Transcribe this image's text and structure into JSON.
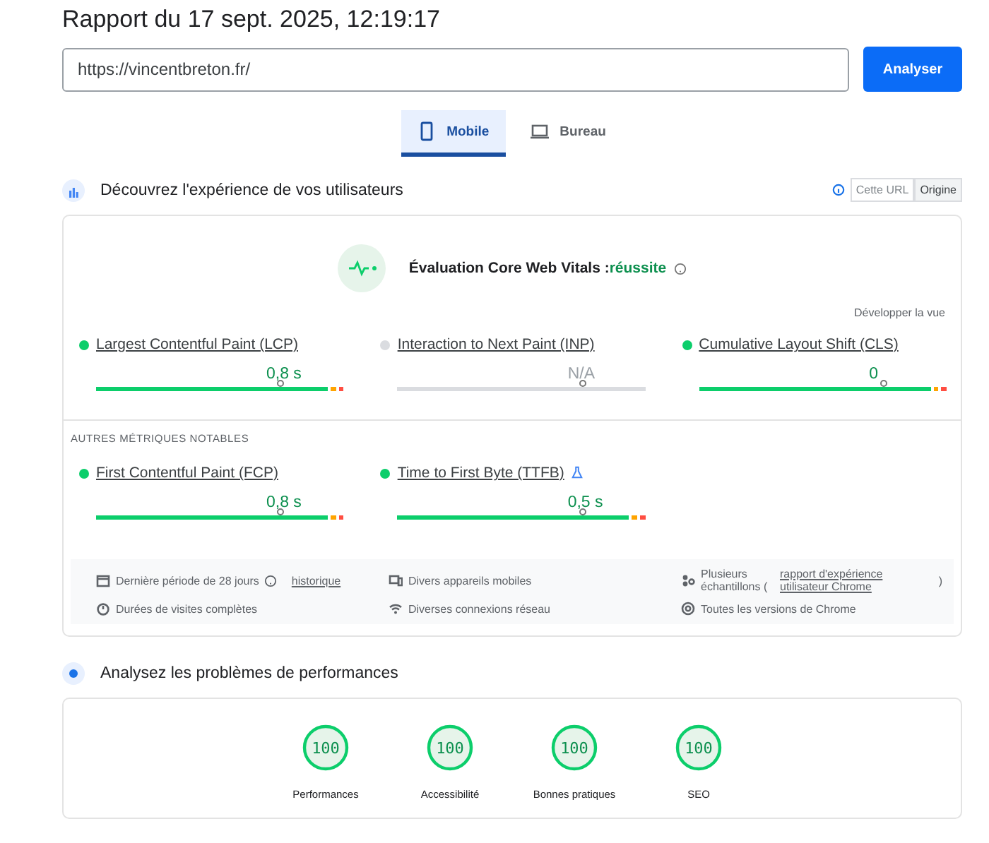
{
  "title": "Rapport du 17 sept. 2025, 12:19:17",
  "url_field": {
    "value": "https://vincentbreton.fr/"
  },
  "analyze_button": "Analyser",
  "tabs": [
    {
      "label": "Mobile",
      "selected": true
    },
    {
      "label": "Bureau",
      "selected": false
    }
  ],
  "experience": {
    "heading": "Découvrez l'expérience de vos utilisateurs",
    "toggle": [
      {
        "label": "Cette URL",
        "selected": false,
        "disabled": true
      },
      {
        "label": "Origine",
        "selected": true,
        "disabled": false
      }
    ],
    "assessment_label": "Évaluation Core Web Vitals :",
    "assessment_result": "réussite",
    "expand_link": "Développer la vue",
    "core_metrics": [
      {
        "name": "Largest Contentful Paint (LCP)",
        "value": "0,8 s",
        "color": "#0cce6b",
        "kind": "rated",
        "level": 0.75,
        "lab": false
      },
      {
        "name": "Interaction to Next Paint (INP)",
        "value": "N/A",
        "color": "#dadce0",
        "kind": "empty",
        "level": 0.75,
        "lab": false
      },
      {
        "name": "Cumulative Layout Shift (CLS)",
        "value": "0",
        "color": "#0cce6b",
        "kind": "rated",
        "level": 0.75,
        "lab": false
      }
    ],
    "other_heading": "AUTRES MÉTRIQUES NOTABLES",
    "other_metrics": [
      {
        "name": "First Contentful Paint (FCP)",
        "value": "0,8 s",
        "color": "#0cce6b",
        "kind": "rated",
        "level": 0.75,
        "lab": false
      },
      {
        "name": "Time to First Byte (TTFB)",
        "value": "0,5 s",
        "color": "#0cce6b",
        "kind": "rated",
        "level": 0.75,
        "lab": true
      }
    ],
    "footer": [
      {
        "text": "Dernière période de 28 jours",
        "help": true,
        "link": "historique"
      },
      {
        "text": "Divers appareils mobiles",
        "help": false
      },
      {
        "text": "Plusieurs échantillons (",
        "link": "rapport d'expérience utilisateur Chrome",
        "close": ")",
        "help": false
      },
      {
        "text": "Durées de visites complètes",
        "help": false
      },
      {
        "text": "Diverses connexions réseau",
        "help": false
      },
      {
        "text": "Toutes les versions de Chrome",
        "help": false
      }
    ]
  },
  "diagnose": {
    "heading": "Analysez les problèmes de performances",
    "scores": [
      {
        "score": "100",
        "label": "Performances",
        "color": "#0cce6b"
      },
      {
        "score": "100",
        "label": "Accessibilité",
        "color": "#0cce6b"
      },
      {
        "score": "100",
        "label": "Bonnes pratiques",
        "color": "#0cce6b"
      },
      {
        "score": "100",
        "label": "SEO",
        "color": "#0cce6b"
      }
    ]
  }
}
